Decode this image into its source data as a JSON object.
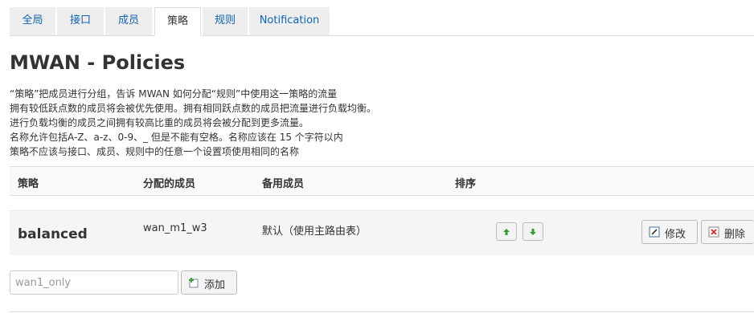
{
  "tabs": [
    {
      "label": "全局",
      "active": false
    },
    {
      "label": "接口",
      "active": false
    },
    {
      "label": "成员",
      "active": false
    },
    {
      "label": "策略",
      "active": true
    },
    {
      "label": "规则",
      "active": false
    },
    {
      "label": "Notification",
      "active": false
    }
  ],
  "page_title": "MWAN - Policies",
  "description": [
    "“策略”把成员进行分组，告诉 MWAN 如何分配“规则”中使用这一策略的流量",
    "拥有较低跃点数的成员将会被优先使用。拥有相同跃点数的成员把流量进行负载均衡。",
    "进行负载均衡的成员之间拥有较高比重的成员将会被分配到更多流量。",
    "名称允许包括A-Z、a-z、0-9、_ 但是不能有空格。名称应该在 15 个字符以内",
    "策略不应该与接口、成员、规则中的任意一个设置项使用相同的名称"
  ],
  "table": {
    "headers": {
      "policy": "策略",
      "assigned": "分配的成员",
      "backup": "备用成员",
      "sort": "排序"
    },
    "rows": [
      {
        "name": "balanced",
        "assigned": "wan_m1_w3",
        "backup": "默认（使用主路由表）",
        "edit_label": "修改",
        "delete_label": "删除"
      }
    ]
  },
  "add": {
    "placeholder": "wan1_only",
    "button_label": "添加"
  },
  "colors": {
    "link": "#0e63b6",
    "tab_bg": "#eeeeee",
    "up_arrow": "#2e9e2e"
  }
}
